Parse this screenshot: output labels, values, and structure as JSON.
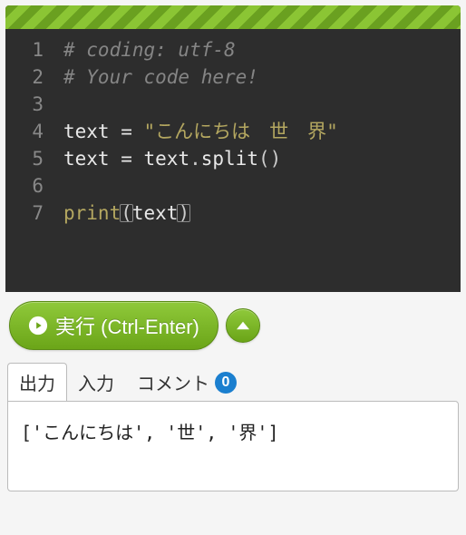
{
  "editor": {
    "line_numbers": [
      "1",
      "2",
      "3",
      "4",
      "5",
      "6",
      "7"
    ],
    "code": {
      "l1_comment": "# coding: utf-8",
      "l2_comment": "# Your code here!",
      "l4_var": "text",
      "l4_eq": " = ",
      "l4_str": "\"こんにちは　世　界\"",
      "l5_var1": "text",
      "l5_eq": " = ",
      "l5_var2": "text",
      "l5_dot": ".",
      "l5_method": "split",
      "l5_parens": "()",
      "l7_builtin": "print",
      "l7_open": "(",
      "l7_arg": "text",
      "l7_close": ")"
    }
  },
  "controls": {
    "run_label": "実行 (Ctrl-Enter)"
  },
  "tabs": {
    "output": "出力",
    "input": "入力",
    "comment": "コメント",
    "comment_badge": "0"
  },
  "output": {
    "text": "['こんにちは', '世', '界']"
  }
}
